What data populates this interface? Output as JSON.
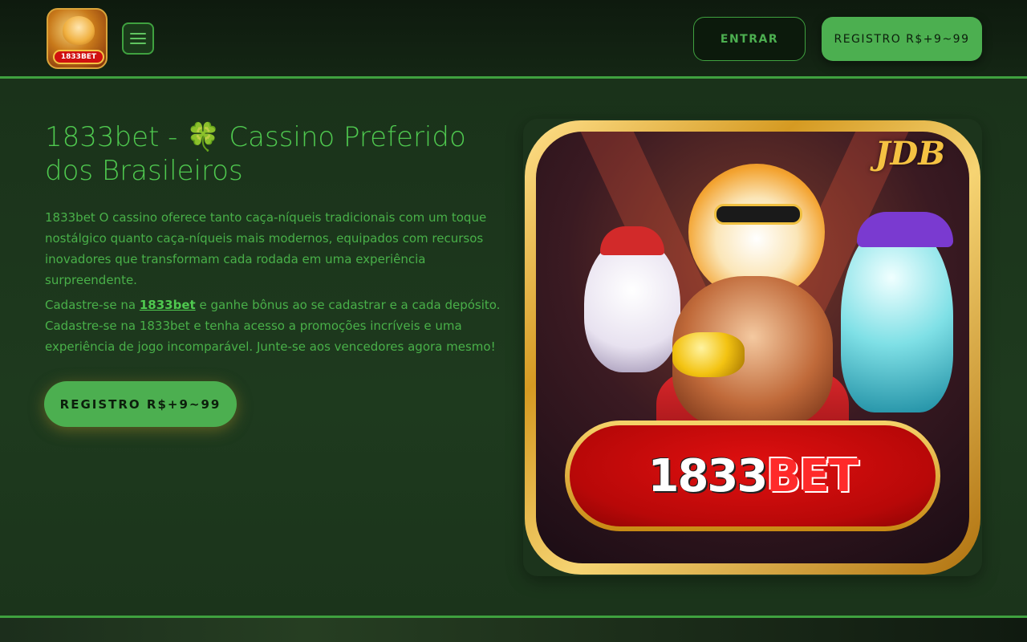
{
  "header": {
    "logo_text": "1833BET",
    "login_label": "ENTRAR",
    "register_label": "REGISTRO R$+9~99"
  },
  "hero": {
    "title_prefix": "1833bet - ",
    "title_icon": "🍀",
    "title_suffix": " Cassino Preferido dos Brasileiros",
    "paragraph1": "1833bet O cassino oferece tanto caça-níqueis tradicionais com um toque nostálgico quanto caça-níqueis mais modernos, equipados com recursos inovadores que transformam cada rodada em uma experiência surpreendente.",
    "paragraph2_before": "Cadastre-se na ",
    "paragraph2_link": "1833bet",
    "paragraph2_after": " e ganhe bônus ao se cadastrar e a cada depósito. Cadastre-se na 1833bet e tenha acesso a promoções incríveis e uma experiência de jogo incomparável. Junte-se aos vencedores agora mesmo!",
    "cta_label": "REGISTRO R$+9~99"
  },
  "image": {
    "corner_mark": "JDB",
    "banner_number": "1833",
    "banner_word": "BET"
  },
  "colors": {
    "accent": "#4caf50",
    "background": "#1a321a",
    "header_bg": "#0e1a0e"
  },
  "icons": {
    "menu": "hamburger-menu-icon",
    "title": "four-leaf-clover-icon"
  }
}
